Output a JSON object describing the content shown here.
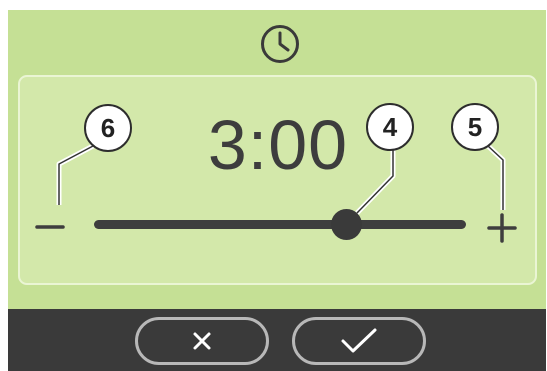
{
  "timer": {
    "value": "3:00",
    "slider_position": 0.68
  },
  "callouts": {
    "minus": "6",
    "slider": "4",
    "plus": "5"
  },
  "icons": {
    "header": "clock-icon",
    "decrease": "minus-icon",
    "increase": "plus-icon",
    "cancel": "close-icon",
    "confirm": "checkmark-icon"
  },
  "colors": {
    "screen_background": "#c5e095",
    "panel_background": "#d3e8aa",
    "panel_border": "#eaf5d4",
    "footer_background": "#3a3a3a",
    "button_outline": "#b8b8b8",
    "foreground": "#3e3e3e"
  }
}
